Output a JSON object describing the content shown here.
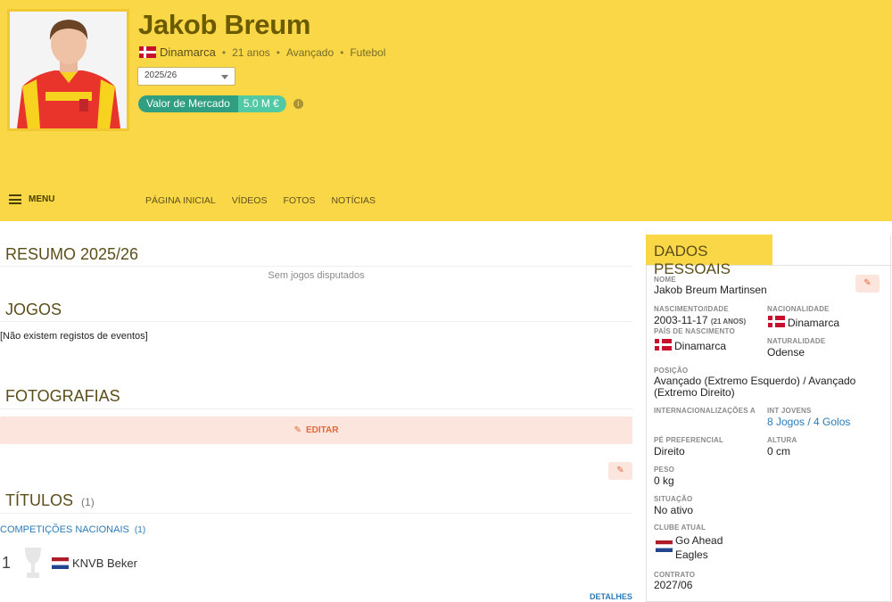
{
  "header": {
    "player_name": "Jakob Breum",
    "country": "Dinamarca",
    "age": "21 anos",
    "position": "Avançado",
    "sport": "Futebol",
    "season_selected": "2025/26",
    "market_value_label": "Valor de Mercado",
    "market_value": "5.0 M €",
    "info_icon": "i"
  },
  "nav": {
    "menu_label": "MENU",
    "links": [
      "PÁGINA INICIAL",
      "VÍDEOS",
      "FOTOS",
      "NOTÍCIAS"
    ]
  },
  "main": {
    "summary_title": "RESUMO 2025/26",
    "summary_empty": "Sem jogos disputados",
    "games_title": "JOGOS",
    "games_empty": "[Não existem registos de eventos]",
    "photos_title": "FOTOGRAFIAS",
    "edit_label": "EDITAR",
    "titles_title": "TÍTULOS",
    "titles_count": "(1)",
    "competitions_label": "COMPETIÇÕES NACIONAIS",
    "competitions_count": "(1)",
    "trophies": [
      {
        "count": "1",
        "name": "KNVB Beker",
        "flag": "netherlands"
      }
    ],
    "details_link": "DETALHES"
  },
  "personal": {
    "title": "DADOS PESSOAIS",
    "name_label": "NOME",
    "name_value": "Jakob Breum Martinsen",
    "birth_label": "NASCIMENTO/IDADE",
    "birth_value": "2003-11-17",
    "birth_age": "(21 ANOS)",
    "nationality_label": "NACIONALIDADE",
    "nationality_value": "Dinamarca",
    "birth_country_label": "PAÍS DE NASCIMENTO",
    "birth_country_value": "Dinamarca",
    "birthplace_label": "NATURALIDADE",
    "birthplace_value": "Odense",
    "position_label": "POSIÇÃO",
    "position_value_1": "Avançado (Extremo Esquerdo) / Avançado",
    "position_value_2": "(Extremo Direito)",
    "int_a_label": "INTERNACIONALIZAÇÕES A",
    "int_youth_label": "INT JOVENS",
    "int_youth_value": "8 Jogos / 4 Golos",
    "foot_label": "PÉ PREFERENCIAL",
    "foot_value": "Direito",
    "height_label": "ALTURA",
    "height_value": "0 cm",
    "weight_label": "PESO",
    "weight_value": "0 kg",
    "status_label": "SITUAÇÃO",
    "status_value": "No ativo",
    "club_label": "CLUBE ATUAL",
    "club_value_1": "Go Ahead",
    "club_value_2": "Eagles",
    "contract_label": "CONTRATO",
    "contract_value": "2027/06"
  },
  "colors": {
    "header_bg": "#fad746",
    "accent_orange": "#e4683b",
    "market_green": "#2f9e81",
    "link_blue": "#2a7bb8"
  },
  "icons": {
    "menu": "hamburger-icon",
    "edit": "pencil-icon",
    "trophy": "trophy-icon",
    "info": "info-icon"
  }
}
